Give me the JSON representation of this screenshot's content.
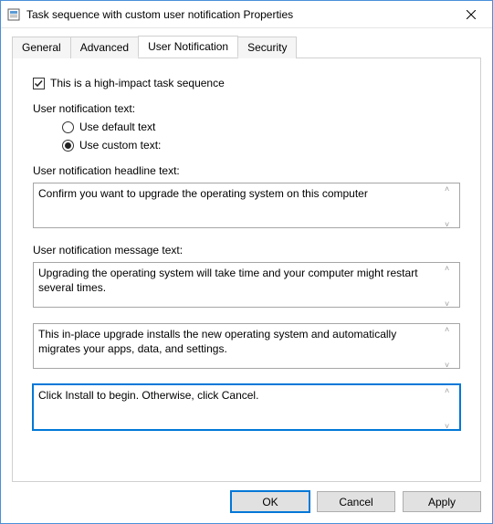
{
  "window": {
    "title": "Task sequence with custom user notification Properties"
  },
  "tabs": {
    "general": "General",
    "advanced": "Advanced",
    "userNotification": "User Notification",
    "security": "Security",
    "active": "userNotification"
  },
  "panel": {
    "highImpact": {
      "label": "This is a high-impact task sequence",
      "checked": true
    },
    "userNotificationTextLabel": "User notification text:",
    "radios": {
      "default": {
        "label": "Use default text",
        "checked": false
      },
      "custom": {
        "label": "Use custom text:",
        "checked": true
      }
    },
    "headlineLabel": "User notification headline text:",
    "headlineValue": "Confirm you want to upgrade the operating system on this computer",
    "messageLabel": "User notification message text:",
    "message1": "Upgrading the operating system will take time and your computer might restart several times.",
    "message2": "This in-place upgrade installs the new operating system and automatically migrates your apps, data, and settings.",
    "message3": "Click Install to begin. Otherwise, click Cancel."
  },
  "buttons": {
    "ok": "OK",
    "cancel": "Cancel",
    "apply": "Apply"
  }
}
